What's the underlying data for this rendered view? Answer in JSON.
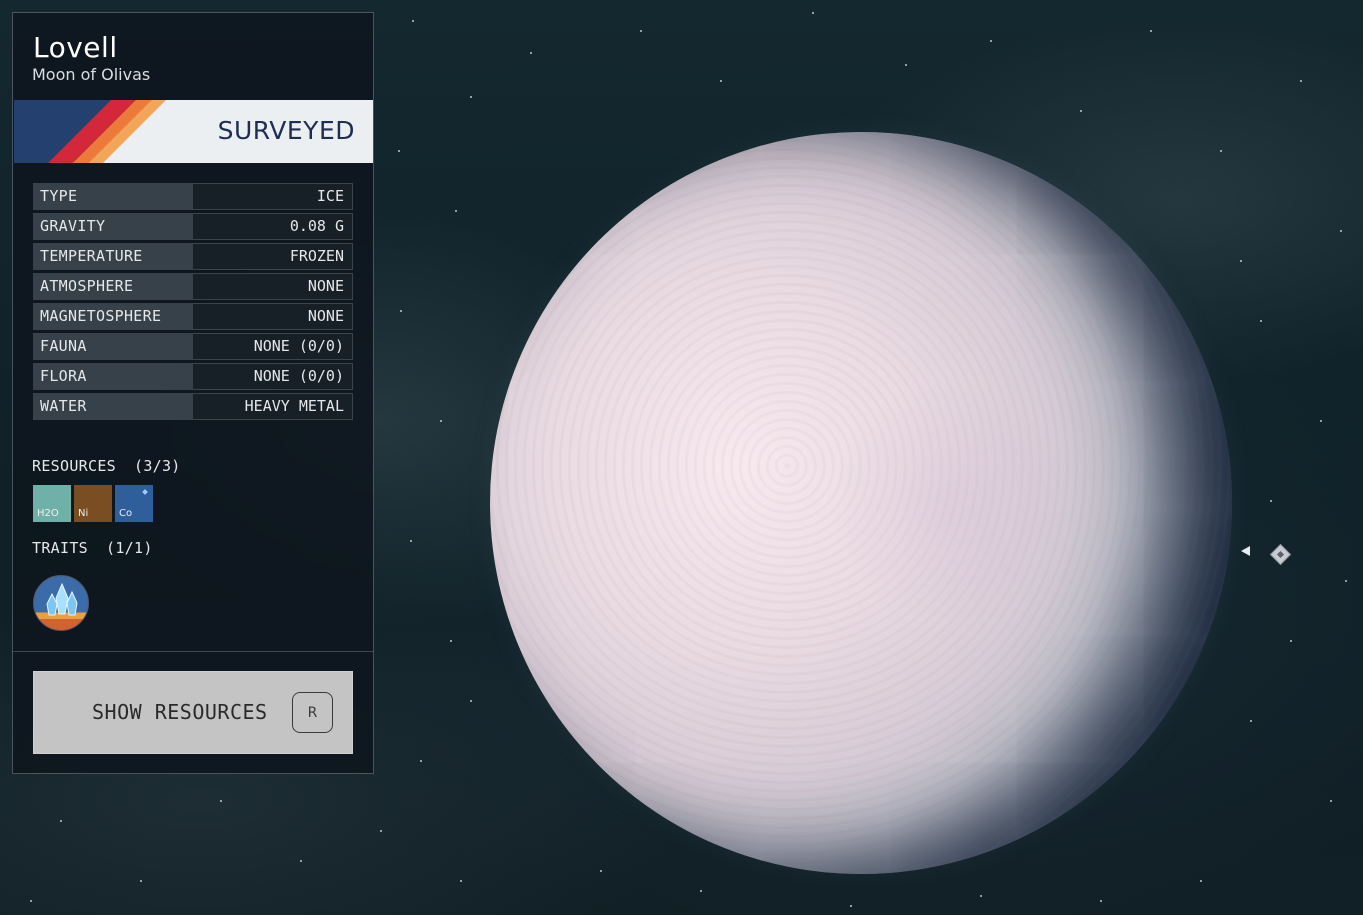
{
  "body": {
    "name": "Lovell",
    "subtitle": "Moon of Olivas",
    "status": "SURVEYED"
  },
  "stats": [
    {
      "label": "TYPE",
      "value": "ICE"
    },
    {
      "label": "GRAVITY",
      "value": "0.08 G"
    },
    {
      "label": "TEMPERATURE",
      "value": "FROZEN"
    },
    {
      "label": "ATMOSPHERE",
      "value": "NONE"
    },
    {
      "label": "MAGNETOSPHERE",
      "value": "NONE"
    },
    {
      "label": "FAUNA",
      "value": "NONE (0/0)"
    },
    {
      "label": "FLORA",
      "value": "NONE (0/0)"
    },
    {
      "label": "WATER",
      "value": "HEAVY METAL"
    }
  ],
  "resources": {
    "label": "RESOURCES",
    "count": "(3/3)",
    "items": [
      {
        "symbol": "H2O",
        "color": "#6fb0a8"
      },
      {
        "symbol": "Ni",
        "color": "#7a4e22"
      },
      {
        "symbol": "Co",
        "color": "#2f5f9a"
      }
    ]
  },
  "traits": {
    "label": "TRAITS",
    "count": "(1/1)",
    "items": [
      {
        "icon": "crystal-trait-icon"
      }
    ]
  },
  "actions": {
    "show_resources_label": "SHOW RESOURCES",
    "show_resources_key": "R"
  },
  "colors": {
    "banner_navy": "#24406e",
    "stripe_red": "#d2283a",
    "stripe_orange": "#ec7a3a",
    "stripe_amber": "#f2a65a"
  }
}
